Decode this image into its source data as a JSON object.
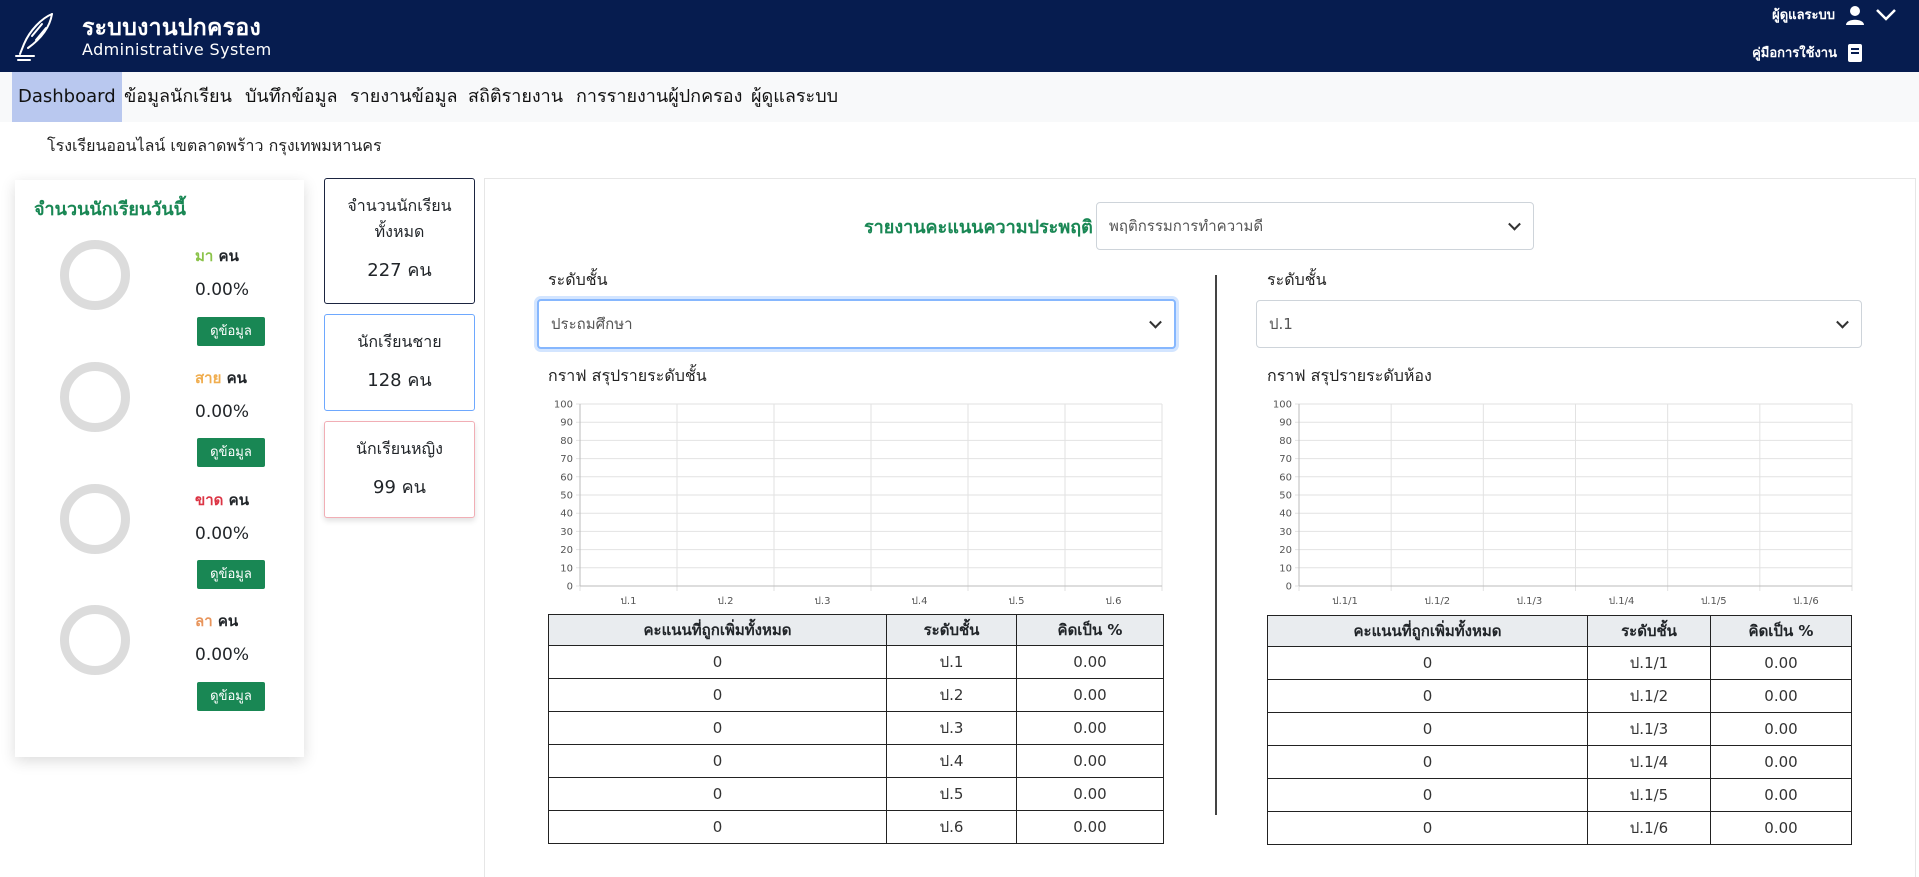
{
  "header": {
    "title_th": "ระบบงานปกครอง",
    "title_en": "Administrative System",
    "user_label": "ผู้ดูแลระบบ",
    "manual_label": "คู่มือการใช้งาน"
  },
  "nav": {
    "items": [
      {
        "label": "Dashboard",
        "active": true
      },
      {
        "label": "ข้อมูลนักเรียน",
        "active": false
      },
      {
        "label": "บันทึกข้อมูล",
        "active": false
      },
      {
        "label": "รายงานข้อมูล",
        "active": false
      },
      {
        "label": "สถิติรายงาน",
        "active": false
      },
      {
        "label": "การรายงานผู้ปกครอง",
        "active": false
      },
      {
        "label": "ผู้ดูแลระบบ",
        "active": false
      }
    ]
  },
  "school_name": "โรงเรียนออนไลน์ เขตลาดพร้าว กรุงเทพมหานคร",
  "today": {
    "title": "จำนวนนักเรียนวันนี้",
    "unit": "คน",
    "button_label": "ดูข้อมูล",
    "stats": [
      {
        "label": "มา",
        "value": "0.00%",
        "color": "#8bc34a"
      },
      {
        "label": "สาย",
        "value": "0.00%",
        "color": "#f0ad4e"
      },
      {
        "label": "ขาด",
        "value": "0.00%",
        "color": "#dc3545"
      },
      {
        "label": "ลา",
        "value": "0.00%",
        "color": "#e8955c"
      }
    ]
  },
  "counts": {
    "total": {
      "label_1": "จำนวนนักเรียน",
      "label_2": "ทั้งหมด",
      "value": "227 คน"
    },
    "male": {
      "label": "นักเรียนชาย",
      "value": "128 คน"
    },
    "female": {
      "label": "นักเรียนหญิง",
      "value": "99 คน"
    }
  },
  "report": {
    "title": "รายงานคะแนนความประพฤติ",
    "behavior_select": "พฤติกรรมการทำความดี"
  },
  "left_panel": {
    "level_label": "ระดับชั้น",
    "level_select": "ประถมศึกษา",
    "graph_title": "กราฟ สรุปรายระดับชั้น",
    "table_headers": [
      "คะแนนที่ถูกเพิ่มทั้งหมด",
      "ระดับชั้น",
      "คิดเป็น %"
    ],
    "rows": [
      [
        "0",
        "ป.1",
        "0.00"
      ],
      [
        "0",
        "ป.2",
        "0.00"
      ],
      [
        "0",
        "ป.3",
        "0.00"
      ],
      [
        "0",
        "ป.4",
        "0.00"
      ],
      [
        "0",
        "ป.5",
        "0.00"
      ],
      [
        "0",
        "ป.6",
        "0.00"
      ]
    ]
  },
  "right_panel": {
    "level_label": "ระดับชั้น",
    "level_select": "ป.1",
    "graph_title": "กราฟ สรุปรายระดับห้อง",
    "table_headers": [
      "คะแนนที่ถูกเพิ่มทั้งหมด",
      "ระดับชั้น",
      "คิดเป็น %"
    ],
    "rows": [
      [
        "0",
        "ป.1/1",
        "0.00"
      ],
      [
        "0",
        "ป.1/2",
        "0.00"
      ],
      [
        "0",
        "ป.1/3",
        "0.00"
      ],
      [
        "0",
        "ป.1/4",
        "0.00"
      ],
      [
        "0",
        "ป.1/5",
        "0.00"
      ],
      [
        "0",
        "ป.1/6",
        "0.00"
      ]
    ]
  },
  "chart_data": [
    {
      "type": "bar",
      "categories": [
        "ป.1",
        "ป.2",
        "ป.3",
        "ป.4",
        "ป.5",
        "ป.6"
      ],
      "values": [
        0,
        0,
        0,
        0,
        0,
        0
      ],
      "ylim": [
        0,
        100
      ],
      "yticks": [
        0,
        10,
        20,
        30,
        40,
        50,
        60,
        70,
        80,
        90,
        100
      ],
      "grid": true
    },
    {
      "type": "bar",
      "categories": [
        "ป.1/1",
        "ป.1/2",
        "ป.1/3",
        "ป.1/4",
        "ป.1/5",
        "ป.1/6"
      ],
      "values": [
        0,
        0,
        0,
        0,
        0,
        0
      ],
      "ylim": [
        0,
        100
      ],
      "yticks": [
        0,
        10,
        20,
        30,
        40,
        50,
        60,
        70,
        80,
        90,
        100
      ],
      "grid": true
    }
  ]
}
